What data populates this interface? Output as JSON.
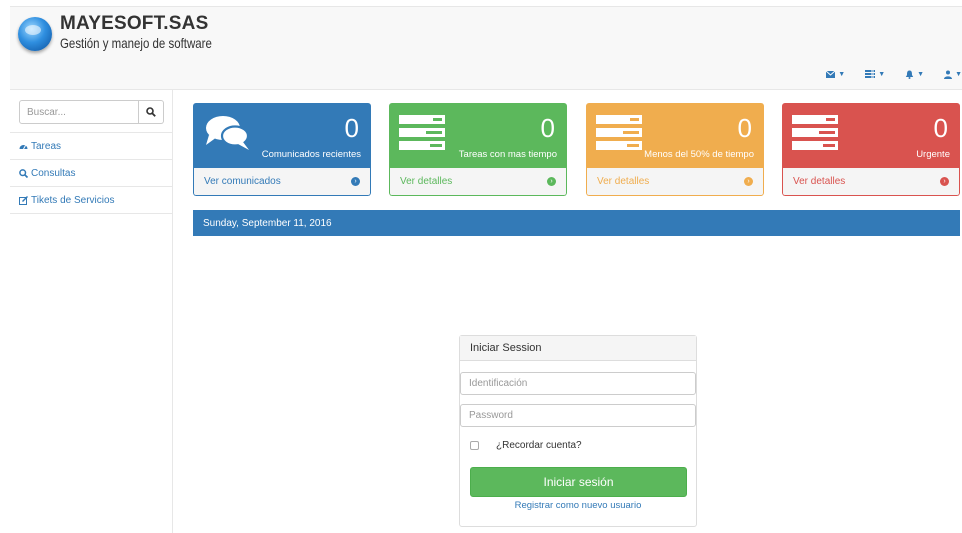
{
  "brand": {
    "title": "MAYESOFT.SAS",
    "subtitle": "Gestión y manejo de software"
  },
  "topnav": {
    "items": [
      {
        "icon": "envelope-icon"
      },
      {
        "icon": "tasks-icon"
      },
      {
        "icon": "bell-icon"
      },
      {
        "icon": "user-icon"
      }
    ]
  },
  "sidebar": {
    "search_placeholder": "Buscar...",
    "items": [
      {
        "label": "Tareas",
        "icon": "dashboard-icon"
      },
      {
        "label": "Consultas",
        "icon": "search-icon"
      },
      {
        "label": "Tikets de Servicios",
        "icon": "edit-icon"
      }
    ]
  },
  "panels": [
    {
      "count": "0",
      "caption": "Comunicados recientes",
      "link": "Ver comunicados",
      "color": "#337ab7",
      "icon": "comments-icon"
    },
    {
      "count": "0",
      "caption": "Tareas con mas tiempo",
      "link": "Ver detalles",
      "color": "#5cb85c",
      "icon": "tasks-icon"
    },
    {
      "count": "0",
      "caption": "Menos del 50% de tiempo",
      "link": "Ver detalles",
      "color": "#f0ad4e",
      "icon": "tasks-icon"
    },
    {
      "count": "0",
      "caption": "Urgente",
      "link": "Ver detalles",
      "color": "#d9534f",
      "icon": "tasks-icon"
    }
  ],
  "datebar": {
    "text": "Sunday, September 11, 2016"
  },
  "login": {
    "title": "Iniciar Session",
    "id_placeholder": "Identificación",
    "password_placeholder": "Password",
    "remember_label": "¿Recordar cuenta?",
    "submit_label": "Iniciar sesión",
    "register_label": "Registrar como nuevo usuario"
  }
}
